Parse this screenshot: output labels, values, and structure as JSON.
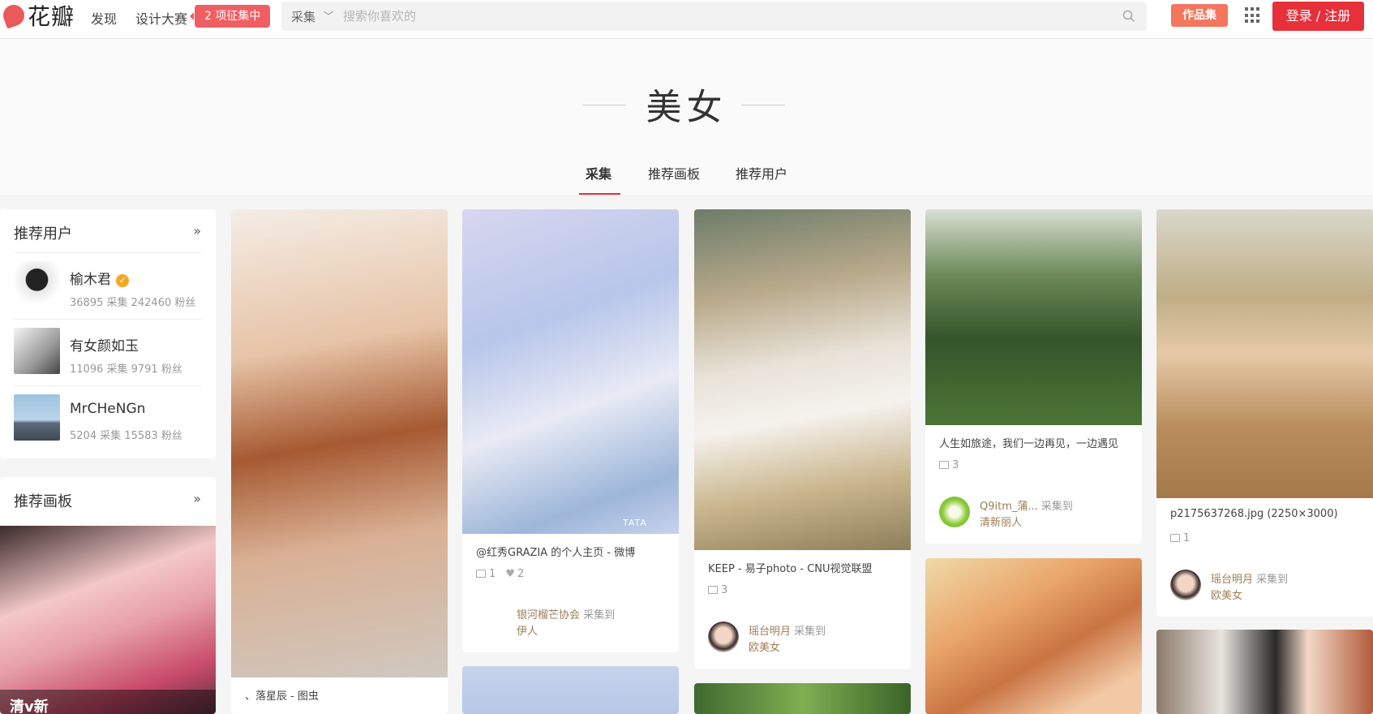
{
  "header": {
    "logo_text": "花瓣",
    "nav_discover": "发现",
    "nav_contest": "设计大赛",
    "contest_badge": "2 项征集中",
    "search_category": "采集",
    "search_placeholder": "搜索你喜欢的",
    "works_button": "作品集",
    "login_button": "登录 / 注册"
  },
  "topic": {
    "title": "美女",
    "tabs": [
      "采集",
      "推荐画板",
      "推荐用户"
    ]
  },
  "sidebar": {
    "users_heading": "推荐用户",
    "more": "»",
    "users": [
      {
        "name": "榆木君",
        "stats": "36895 采集  242460 粉丝",
        "verified": true
      },
      {
        "name": "有女颜如玉",
        "stats": "11096 采集  9791 粉丝",
        "verified": false
      },
      {
        "name": "MrCHeNGn",
        "stats": "5204 采集  15583 粉丝",
        "verified": false
      }
    ],
    "boards_heading": "推荐画板",
    "board_caption": "清v新"
  },
  "pins": [
    {
      "desc": "、落星辰 - 图虫"
    },
    {
      "desc": "@红秀GRAZIA 的个人主页 - 微博",
      "repins": "1",
      "likes": "2",
      "user": "银河榴芒协会",
      "action": "采集到",
      "board": "伊人"
    },
    {
      "desc": "KEEP - 易子photo - CNU视觉联盟",
      "repins": "3",
      "user": "瑶台明月",
      "action": "采集到",
      "board": "欧美女"
    },
    {
      "desc": "人生如旅途，我们一边再见，一边遇见",
      "repins": "3",
      "user": "Q9itm_蒲...",
      "action": "采集到",
      "board": "清新丽人"
    },
    {
      "desc": "p2175637268.jpg (2250×3000)",
      "repins": "1",
      "user": "瑶台明月",
      "action": "采集到",
      "board": "欧美女"
    }
  ],
  "image_watermark": "TATA"
}
